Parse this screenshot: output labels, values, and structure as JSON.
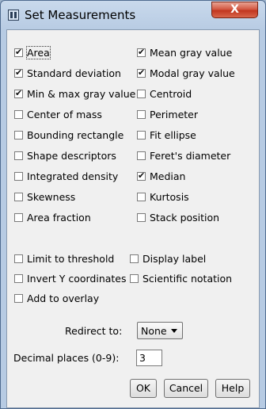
{
  "window": {
    "title": "Set Measurements",
    "close_label": "X"
  },
  "measurements_left": [
    {
      "label": "Area",
      "checked": true
    },
    {
      "label": "Standard deviation",
      "checked": true
    },
    {
      "label": "Min & max gray value",
      "checked": true
    },
    {
      "label": "Center of mass",
      "checked": false
    },
    {
      "label": "Bounding rectangle",
      "checked": false
    },
    {
      "label": "Shape descriptors",
      "checked": false
    },
    {
      "label": "Integrated density",
      "checked": false
    },
    {
      "label": "Skewness",
      "checked": false
    },
    {
      "label": "Area fraction",
      "checked": false
    }
  ],
  "measurements_right": [
    {
      "label": "Mean gray value",
      "checked": true
    },
    {
      "label": "Modal gray value",
      "checked": true
    },
    {
      "label": "Centroid",
      "checked": false
    },
    {
      "label": "Perimeter",
      "checked": false
    },
    {
      "label": "Fit ellipse",
      "checked": false
    },
    {
      "label": "Feret's diameter",
      "checked": false
    },
    {
      "label": "Median",
      "checked": true
    },
    {
      "label": "Kurtosis",
      "checked": false
    },
    {
      "label": "Stack position",
      "checked": false
    }
  ],
  "options_left": [
    {
      "label": "Limit to threshold",
      "checked": false
    },
    {
      "label": "Invert Y coordinates",
      "checked": false
    },
    {
      "label": "Add to overlay",
      "checked": false
    }
  ],
  "options_right": [
    {
      "label": "Display label",
      "checked": false
    },
    {
      "label": "Scientific notation",
      "checked": false
    }
  ],
  "redirect": {
    "label": "Redirect to:",
    "value": "None"
  },
  "decimal": {
    "label": "Decimal places (0-9):",
    "value": "3"
  },
  "buttons": {
    "ok": "OK",
    "cancel": "Cancel",
    "help": "Help"
  }
}
